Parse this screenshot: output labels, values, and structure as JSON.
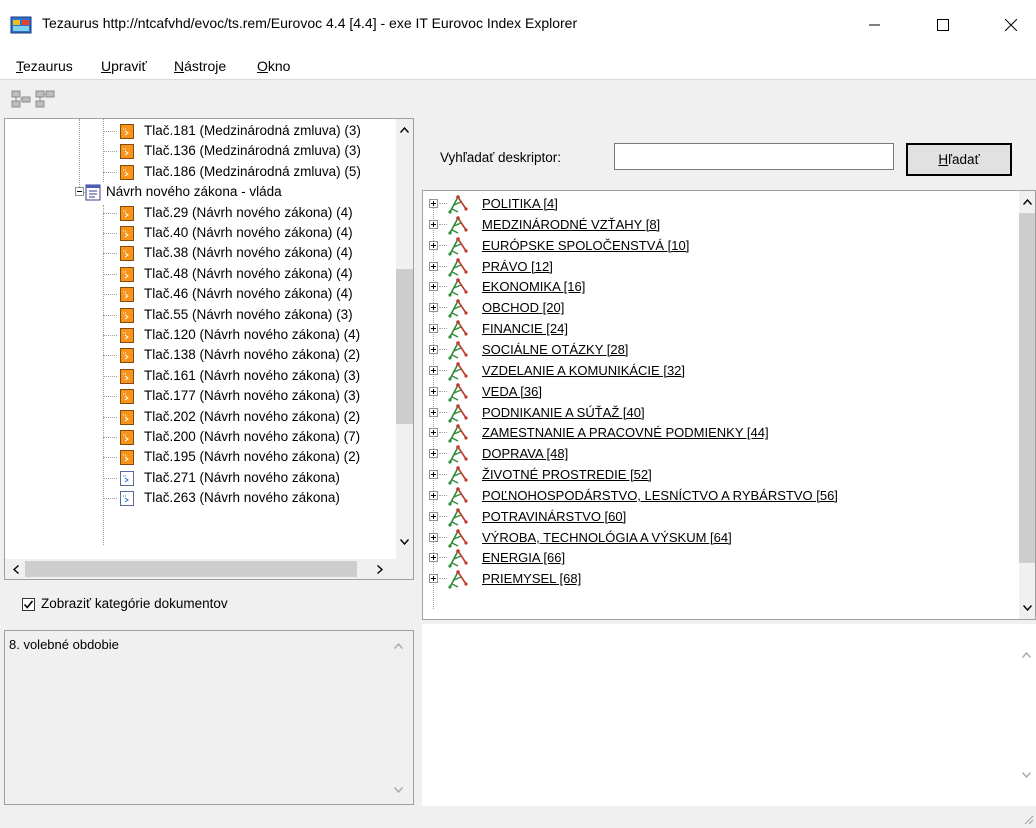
{
  "window": {
    "title": "Tezaurus http://ntcafvhd/evoc/ts.rem/Eurovoc 4.4 [4.4] - exe IT Eurovoc Index Explorer"
  },
  "menu": [
    {
      "label": "Tezaurus",
      "accel": "T",
      "rest": "ezaurus"
    },
    {
      "label": "Upraviť",
      "accel": "U",
      "rest": "praviť"
    },
    {
      "label": "Nástroje",
      "accel": "N",
      "rest": "ástroje"
    },
    {
      "label": "Okno",
      "accel": "O",
      "rest": "kno"
    }
  ],
  "tree": {
    "items": [
      {
        "label": "Tlač.181 (Medzinárodná zmluva) (3)",
        "icon": "document-orange-icon"
      },
      {
        "label": "Tlač.136 (Medzinárodná zmluva) (3)",
        "icon": "document-orange-icon"
      },
      {
        "label": "Tlač.186 (Medzinárodná zmluva) (5)",
        "icon": "document-orange-icon"
      },
      {
        "label": "Návrh nového zákona - vláda",
        "icon": "folder-document-icon",
        "group": true
      },
      {
        "label": "Tlač.29 (Návrh nového zákona) (4)",
        "icon": "document-orange-icon"
      },
      {
        "label": "Tlač.40 (Návrh nového zákona) (4)",
        "icon": "document-orange-icon"
      },
      {
        "label": "Tlač.38 (Návrh nového zákona) (4)",
        "icon": "document-orange-icon"
      },
      {
        "label": "Tlač.48 (Návrh nového zákona) (4)",
        "icon": "document-orange-icon"
      },
      {
        "label": "Tlač.46 (Návrh nového zákona) (4)",
        "icon": "document-orange-icon"
      },
      {
        "label": "Tlač.55 (Návrh nového zákona) (3)",
        "icon": "document-orange-icon"
      },
      {
        "label": "Tlač.120 (Návrh nového zákona) (4)",
        "icon": "document-orange-icon"
      },
      {
        "label": "Tlač.138 (Návrh nového zákona) (2)",
        "icon": "document-orange-icon"
      },
      {
        "label": "Tlač.161 (Návrh nového zákona) (3)",
        "icon": "document-orange-icon"
      },
      {
        "label": "Tlač.177 (Návrh nového zákona) (3)",
        "icon": "document-orange-icon"
      },
      {
        "label": "Tlač.202 (Návrh nového zákona) (2)",
        "icon": "document-orange-icon"
      },
      {
        "label": "Tlač.200 (Návrh nového zákona) (7)",
        "icon": "document-orange-icon"
      },
      {
        "label": "Tlač.195 (Návrh nového zákona) (2)",
        "icon": "document-orange-icon"
      },
      {
        "label": "Tlač.271 (Návrh nového zákona)",
        "icon": "document-blank-icon"
      },
      {
        "label": "Tlač.263 (Návrh nového zákona)",
        "icon": "document-blank-icon"
      }
    ]
  },
  "show_categories": {
    "label": "Zobraziť kategórie dokumentov",
    "checked": true
  },
  "info": {
    "text": "8. volebné obdobie"
  },
  "search": {
    "label": "Vyhľadať deskriptor:",
    "value": "",
    "button_accel": "H",
    "button_rest": "ľadať"
  },
  "descriptors": [
    "POLITIKA [4]",
    "MEDZINÁRODNÉ VZŤAHY [8]",
    "EURÓPSKE SPOLOČENSTVÁ [10]",
    "PRÁVO [12]",
    "EKONOMIKA [16]",
    "OBCHOD [20]",
    "FINANCIE [24]",
    "SOCIÁLNE OTÁZKY [28]",
    "VZDELANIE A KOMUNIKÁCIE [32]",
    "VEDA [36]",
    "PODNIKANIE A SÚŤAŽ [40]",
    "ZAMESTNANIE A PRACOVNÉ PODMIENKY [44]",
    "DOPRAVA [48]",
    "ŽIVOTNÉ PROSTREDIE [52]",
    "POĽNOHOSPODÁRSTVO, LESNÍCTVO A RYBÁRSTVO [56]",
    "POTRAVINÁRSTVO [60]",
    "VÝROBA, TECHNOLÓGIA A VÝSKUM [64]",
    "ENERGIA [66]",
    "PRIEMYSEL [68]"
  ],
  "colors": {
    "doc_orange": "#f7941d",
    "thesaurus_green": "#2e8b3a",
    "thesaurus_red": "#c0392b"
  }
}
